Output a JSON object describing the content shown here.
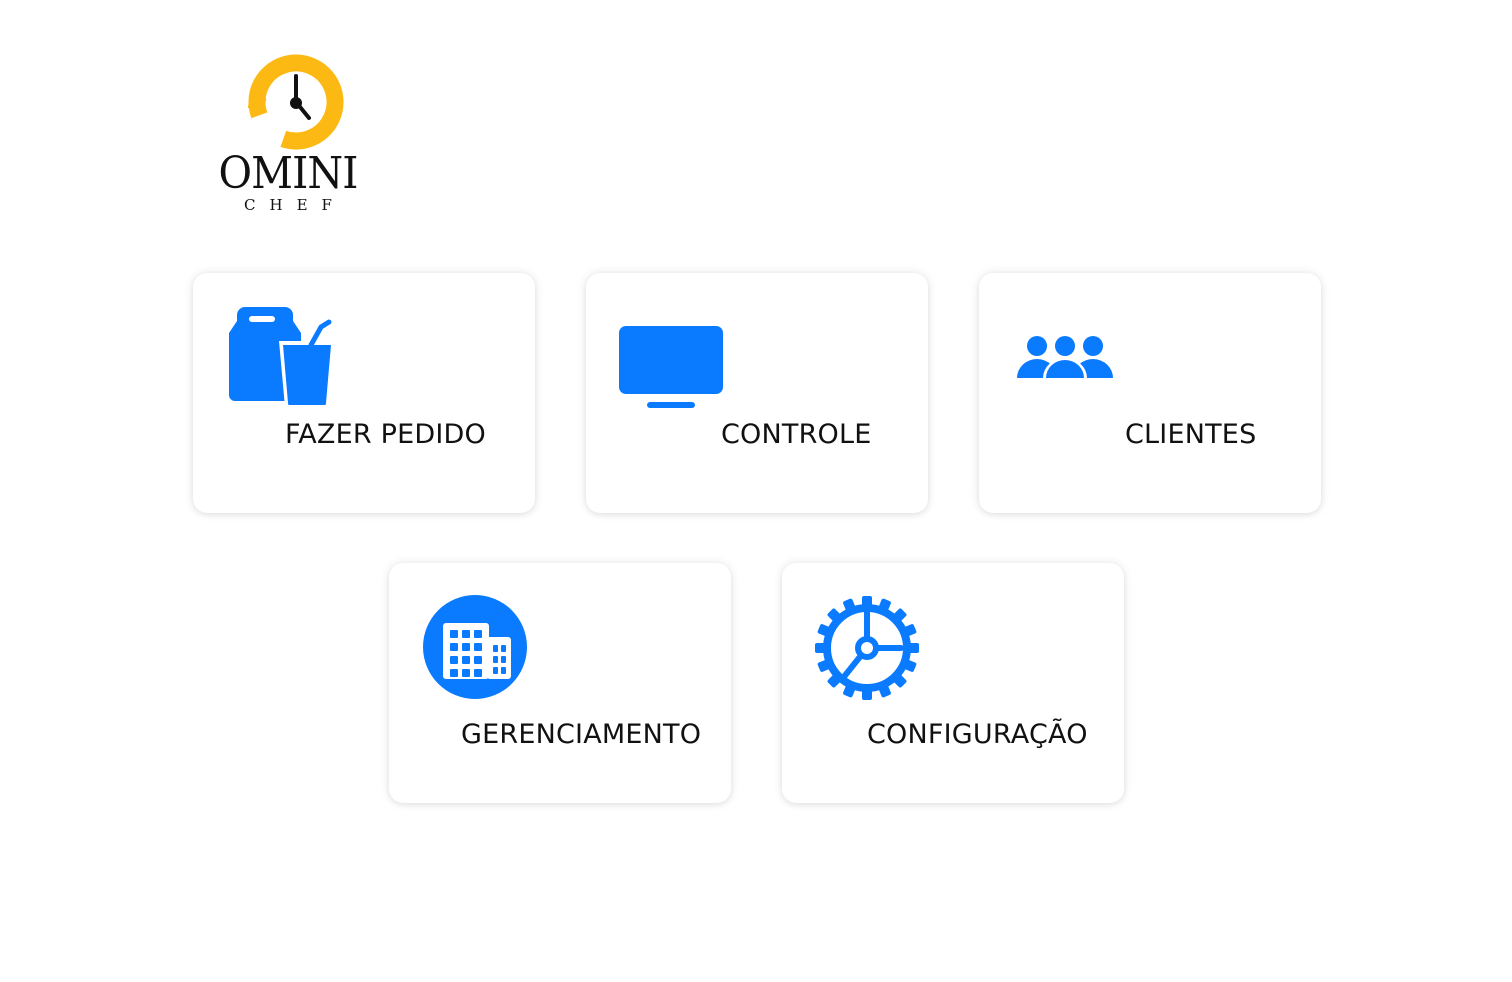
{
  "brand": {
    "title": "OMINI",
    "subtitle": "CHEF",
    "accent_color": "#FDB913"
  },
  "theme": {
    "icon_color": "#0A7BFF"
  },
  "menu": [
    {
      "label": "FAZER PEDIDO",
      "icon": "food-bag-drink-icon"
    },
    {
      "label": "CONTROLE",
      "icon": "monitor-icon"
    },
    {
      "label": "CLIENTES",
      "icon": "users-group-icon"
    },
    {
      "label": "GERENCIAMENTO",
      "icon": "building-icon"
    },
    {
      "label": "CONFIGURAÇÃO",
      "icon": "gear-icon"
    }
  ]
}
